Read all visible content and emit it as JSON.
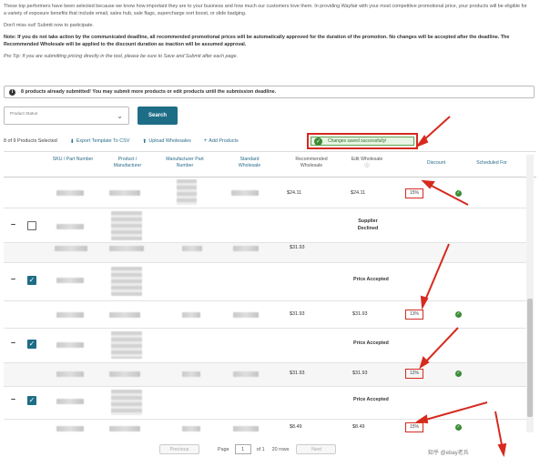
{
  "intro": {
    "p1": "These top performers have been selected because we know how important they are to your business and how much our customers love them. In providing Wayfair with your most competitive promotional price, your products will be eligible for a variety of exposure benefits that include email, sales hub, sale flags, supercharge sort boost, or slide badging.",
    "p2": "Don't miss out! Submit now to participate.",
    "p3": "Note: If you do not take action by the communicated deadline, all recommended promotional prices will be automatically approved for the duration of the promotion. No changes will be accepted after the deadline. The Recommended Wholesale will be applied to the discount duration as inaction will be assumed approval.",
    "p4": "Pro Tip: If you are submitting pricing directly in the tool, please be sure to Save and Submit after each page."
  },
  "banner": {
    "text": "8 products already submitted! You may submit more products or edit products until the submission deadline."
  },
  "filter": {
    "label": "Product Status",
    "search_label": "Search"
  },
  "toolbar": {
    "selected": "8 of 9 Products Selected",
    "export": "Export Template To CSV",
    "upload": "Upload Wholesales",
    "add": "Add Products"
  },
  "toast": {
    "text": "Changes saved successfully!"
  },
  "columns": {
    "sku": "SKU / Part Number",
    "product": "Product / Manufacturer",
    "mfr_part": "Manufacturer Part Number",
    "standard": "Standard Wholesale",
    "recommended": "Recommended Wholesale",
    "edit": "Edit Wholesale",
    "discount": "Discount",
    "scheduled": "Scheduled For"
  },
  "rows": [
    {
      "type": "data",
      "recommended": "$24.11",
      "edit": "$24.11",
      "discount": "15%",
      "ok": true
    },
    {
      "type": "group",
      "checked": false,
      "status": "Supplier Declined"
    },
    {
      "type": "data",
      "recommended": "$31.93",
      "edit": "",
      "discount": "",
      "ok": false
    },
    {
      "type": "group",
      "checked": true,
      "status": "Price Accepted"
    },
    {
      "type": "data",
      "recommended": "$31.93",
      "edit": "$31.93",
      "discount": "13%",
      "ok": true
    },
    {
      "type": "group",
      "checked": true,
      "status": "Price Accepted"
    },
    {
      "type": "data",
      "recommended": "$31.93",
      "edit": "$31.93",
      "discount": "12%",
      "ok": true
    },
    {
      "type": "group",
      "checked": true,
      "status": "Price Accepted"
    },
    {
      "type": "data",
      "recommended": "$8.49",
      "edit": "$8.49",
      "discount": "15%",
      "ok": true
    }
  ],
  "pager": {
    "previous": "Previous",
    "page_label": "Page",
    "page": "1",
    "of": "of 1",
    "rows": "20 rows",
    "next": "Next"
  },
  "watermark": "知乎 @ebay老兵",
  "colors": {
    "accent": "#1e6d86",
    "highlight": "#d62a1f",
    "success": "#3a8c35"
  }
}
